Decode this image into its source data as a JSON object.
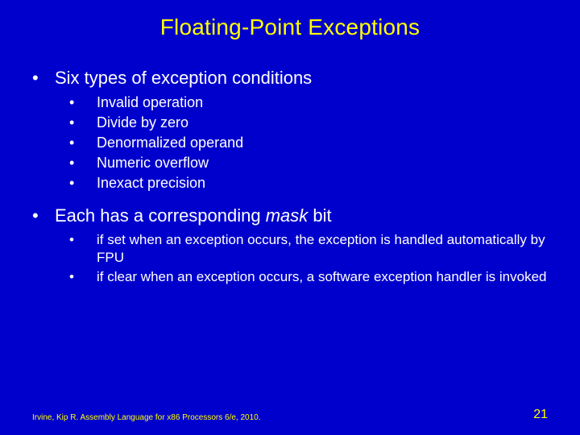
{
  "title": "Floating-Point Exceptions",
  "bullets": {
    "b1": "Six types of exception conditions",
    "b1_items": {
      "i1": "Invalid operation",
      "i2": "Divide by zero",
      "i3": "Denormalized operand",
      "i4": "Numeric overflow",
      "i5": "Inexact precision"
    },
    "b2_prefix": "Each has a corresponding ",
    "b2_italic": "mask",
    "b2_suffix": " bit",
    "b2_items": {
      "j1": "if set when an exception occurs, the exception is handled automatically by FPU",
      "j2": "if clear when an exception occurs, a software exception handler is invoked"
    }
  },
  "footer": {
    "citation": "Irvine, Kip R. Assembly Language for x86 Processors 6/e, 2010.",
    "page": "21"
  },
  "glyphs": {
    "dot": "•"
  }
}
